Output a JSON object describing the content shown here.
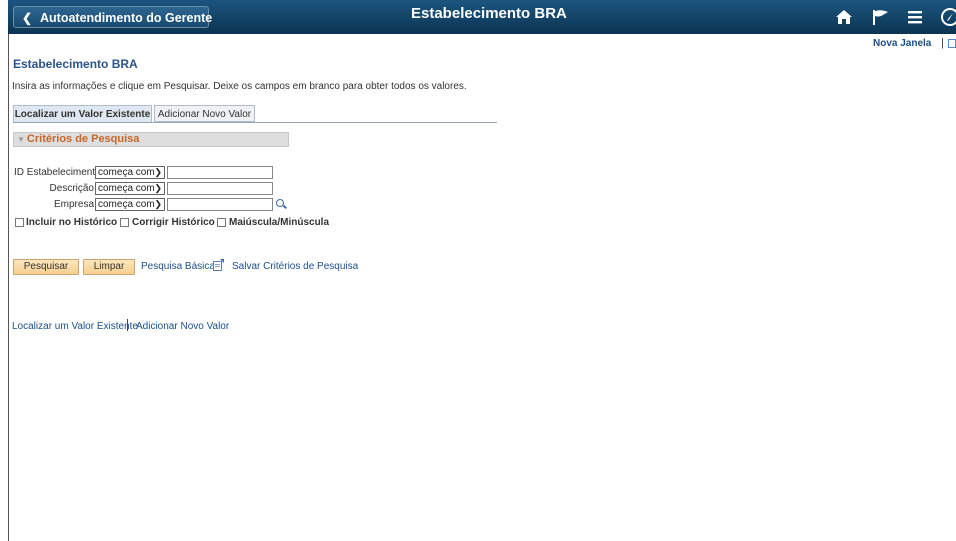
{
  "header": {
    "back_label": "Autoatendimento do Gerente",
    "title": "Estabelecimento BRA",
    "icons": [
      "home-icon",
      "flag-icon",
      "menu-icon",
      "navbar-icon"
    ]
  },
  "top_links": {
    "nova_janela": "Nova Janela",
    "separator": "|"
  },
  "page": {
    "heading": "Estabelecimento BRA",
    "instructions": "Insira as informações e clique em Pesquisar. Deixe os campos em branco para obter todos os valores."
  },
  "tabs": [
    {
      "label": "Localizar um Valor Existente",
      "active": true
    },
    {
      "label": "Adicionar Novo Valor",
      "active": false
    }
  ],
  "criteria": {
    "title": "Critérios de Pesquisa",
    "fields": [
      {
        "label": "ID Estabelecimento",
        "operator": "começa com",
        "value": ""
      },
      {
        "label": "Descrição",
        "operator": "começa com",
        "value": ""
      },
      {
        "label": "Empresa",
        "operator": "começa com",
        "value": ""
      }
    ],
    "checkboxes": [
      {
        "label": "Incluir no Histórico",
        "checked": false
      },
      {
        "label": "Corrigir Histórico",
        "checked": false
      },
      {
        "label": "Maiúscula/Minúscula",
        "checked": false
      }
    ]
  },
  "actions": {
    "search": "Pesquisar",
    "clear": "Limpar",
    "basic_search": "Pesquisa Básica",
    "save_criteria": "Salvar Critérios de Pesquisa"
  },
  "bottom_links": {
    "find": "Localizar um Valor Existente",
    "add": "Adicionar Novo Valor"
  },
  "colors": {
    "header_bg": "#0c3452",
    "heading": "#29548b",
    "criteria_title": "#c7662a",
    "link": "#1b4f8a",
    "button": "#f6cf8f"
  }
}
